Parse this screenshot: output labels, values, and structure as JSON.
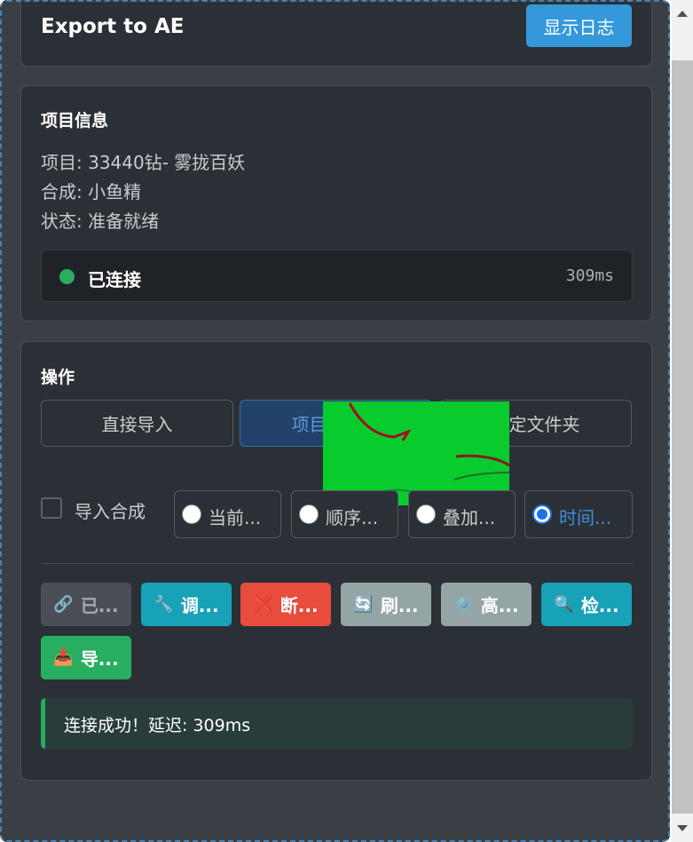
{
  "header": {
    "title": "Export to AE",
    "log_button": "显示日志"
  },
  "info": {
    "section_title": "项目信息",
    "project": "项目: 33440钻- 雾拢百妖",
    "composition": "合成: 小鱼精",
    "state": "状态: 准备就绪",
    "connection": {
      "label": "已连接",
      "latency": "309ms",
      "color": "#27ae60"
    }
  },
  "operations": {
    "section_title": "操作",
    "modes": [
      {
        "label": "直接导入",
        "active": false
      },
      {
        "label": "项目旁复制",
        "active": true
      },
      {
        "label": "指定文件夹",
        "active": false
      }
    ],
    "import_comp_label": "导入合成",
    "radios": [
      {
        "label": "当前...",
        "checked": false
      },
      {
        "label": "顺序...",
        "checked": false
      },
      {
        "label": "叠加...",
        "checked": false
      },
      {
        "label": "时间...",
        "checked": true
      }
    ],
    "buttons": [
      {
        "icon": "link-icon",
        "glyph": "🔗",
        "label": "已..."
      },
      {
        "icon": "wrench-icon",
        "glyph": "🔧",
        "label": "调..."
      },
      {
        "icon": "cross-icon",
        "glyph": "❌",
        "label": "断..."
      },
      {
        "icon": "refresh-icon",
        "glyph": "🔄",
        "label": "刷..."
      },
      {
        "icon": "gear-icon",
        "glyph": "⚙️",
        "label": "高..."
      },
      {
        "icon": "magnifier-icon",
        "glyph": "🔍",
        "label": "检..."
      },
      {
        "icon": "inbox-icon",
        "glyph": "📥",
        "label": "导..."
      }
    ],
    "message": "连接成功！延迟: 309ms"
  }
}
